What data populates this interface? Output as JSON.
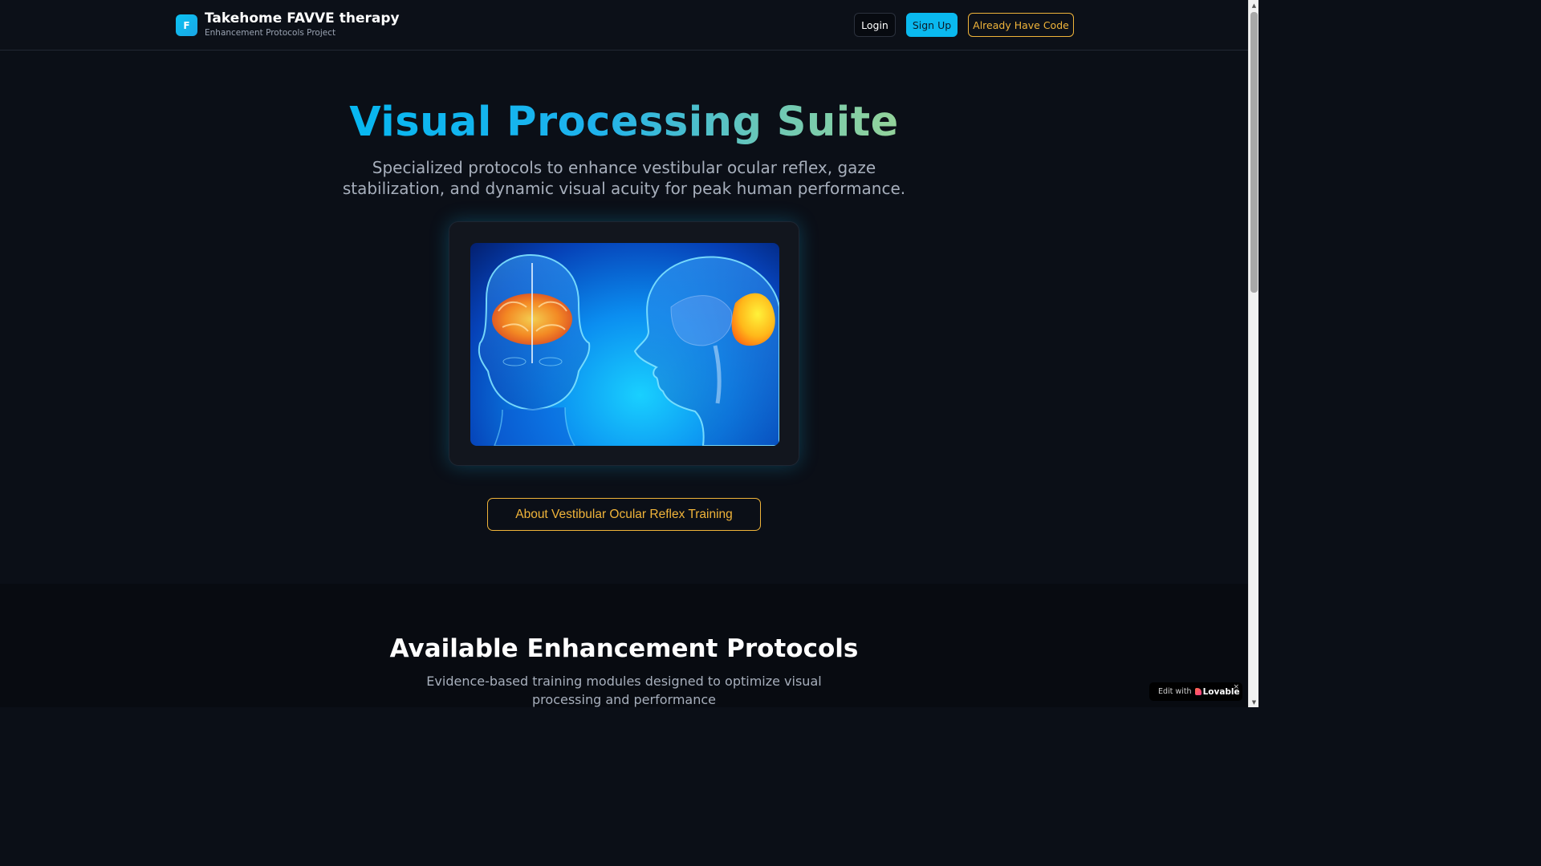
{
  "header": {
    "logo_letter": "F",
    "title": "Takehome FAVVE therapy",
    "subtitle": "Enhancement Protocols Project",
    "login_label": "Login",
    "signup_label": "Sign Up",
    "code_label": "Already Have Code"
  },
  "hero": {
    "title": "Visual Processing Suite",
    "description": "Specialized protocols to enhance vestibular ocular reflex, gaze stabilization, and dynamic visual acuity for peak human performance.",
    "cta_label": "About Vestibular Ocular Reflex Training"
  },
  "protocols": {
    "title": "Available Enhancement Protocols",
    "description": "Evidence-based training modules designed to optimize visual processing and performance"
  },
  "badge": {
    "prefix": "Edit with",
    "brand": "Lovable",
    "close": "×"
  },
  "colors": {
    "accent_cyan": "#0ab9ef",
    "accent_gold": "#f0b43a",
    "background": "#0b0f17"
  }
}
